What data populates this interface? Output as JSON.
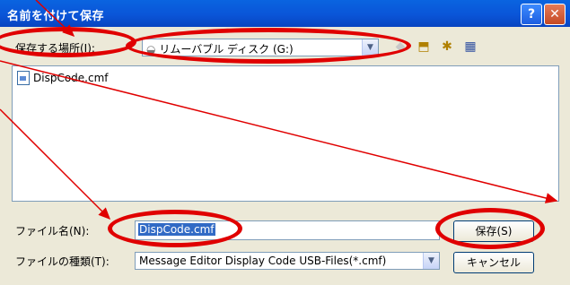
{
  "window": {
    "title": "名前を付けて保存",
    "help_glyph": "?",
    "close_glyph": "✕"
  },
  "location": {
    "label": "保存する場所(I):",
    "value": "リムーバブル ディスク (G:)",
    "icons": [
      "back-icon",
      "up-folder-icon",
      "new-folder-icon",
      "view-menu-icon"
    ]
  },
  "files": [
    {
      "name": "DispCode.cmf"
    }
  ],
  "filename": {
    "label": "ファイル名(N):",
    "value": "DispCode.cmf"
  },
  "filetype": {
    "label": "ファイルの種類(T):",
    "value": "Message Editor Display Code USB-Files(*.cmf)"
  },
  "buttons": {
    "save": "保存(S)",
    "cancel": "キャンセル"
  },
  "annotation_color": "#e00000"
}
